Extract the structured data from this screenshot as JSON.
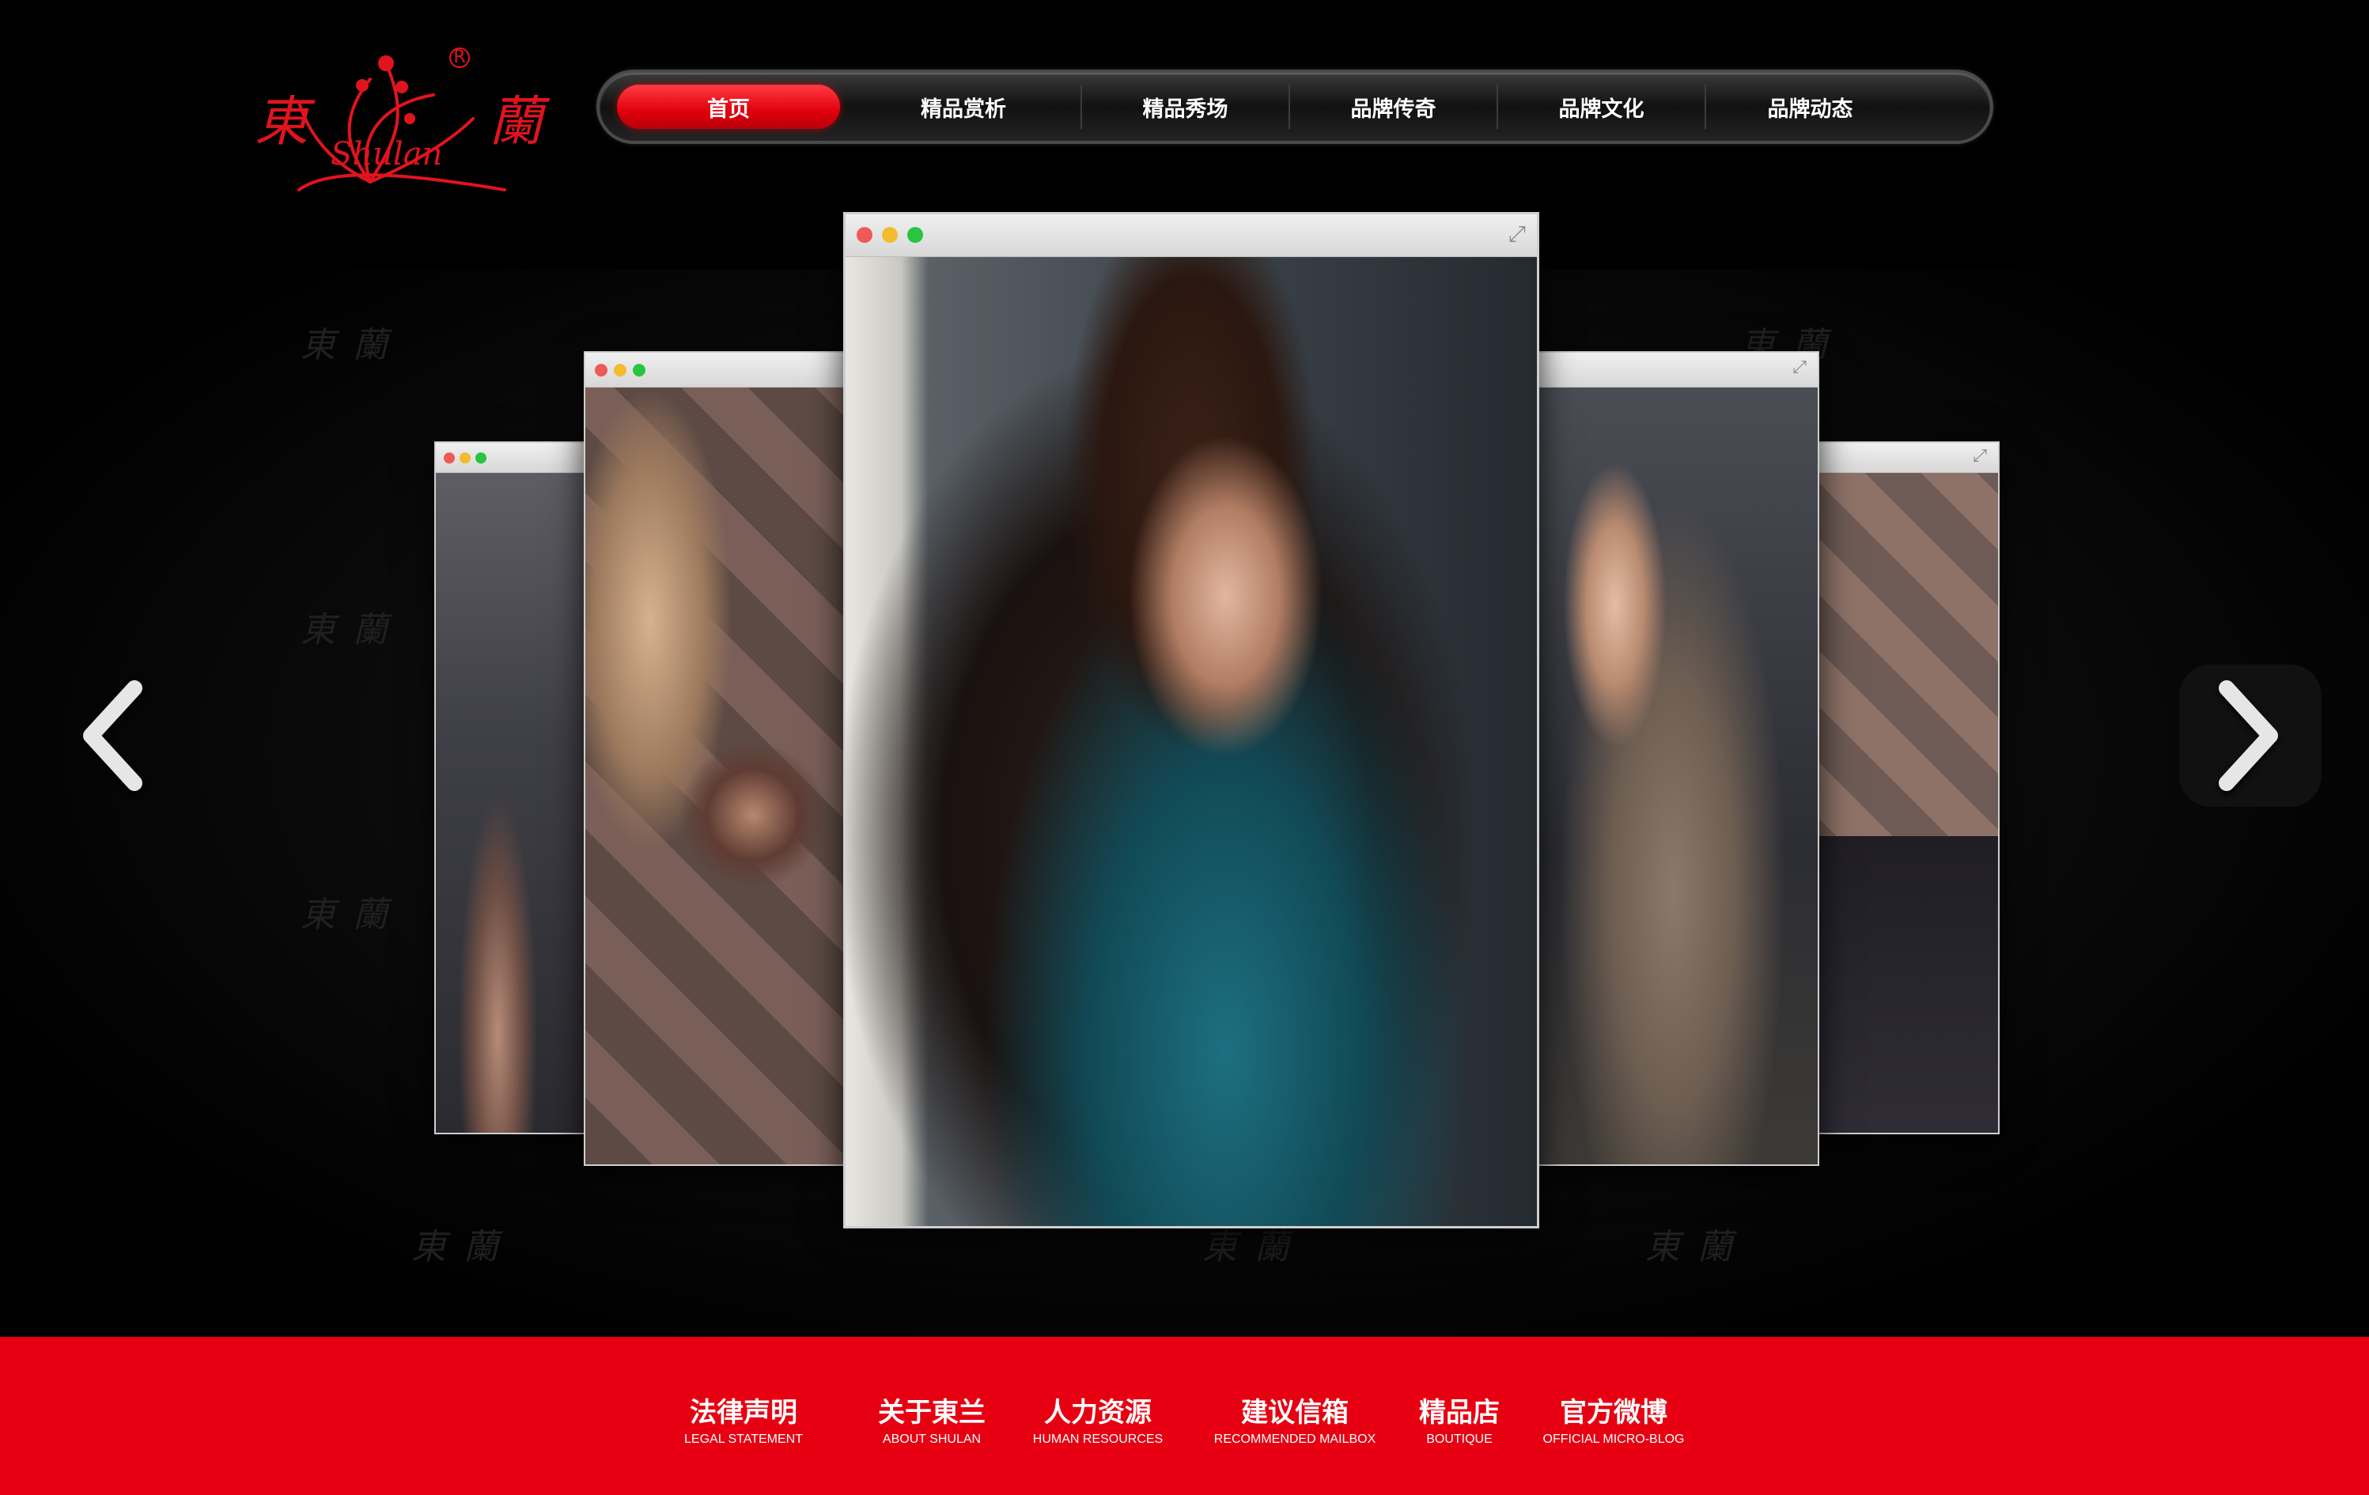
{
  "brand": {
    "logo_cn_left": "東",
    "logo_cn_right": "蘭",
    "logo_script": "Shulan",
    "registered_mark": "R",
    "color": "#e0141e"
  },
  "nav": {
    "items": [
      {
        "label": "首页",
        "active": true
      },
      {
        "label": "精品赏析",
        "active": false
      },
      {
        "label": "精品秀场",
        "active": false
      },
      {
        "label": "品牌传奇",
        "active": false
      },
      {
        "label": "品牌文化",
        "active": false
      },
      {
        "label": "品牌动态",
        "active": false
      }
    ],
    "active_color": "#e1000d"
  },
  "carousel": {
    "prev_icon": "chevron-left-icon",
    "next_icon": "chevron-right-icon",
    "expand_icon": "expand-icon",
    "window_dots": [
      "#ee5a55",
      "#f3bc2e",
      "#27c540"
    ],
    "slides": [
      {
        "name": "slide-far-left"
      },
      {
        "name": "slide-left"
      },
      {
        "name": "slide-center"
      },
      {
        "name": "slide-right"
      },
      {
        "name": "slide-far-right"
      }
    ]
  },
  "footer": {
    "bg_color": "#e60012",
    "links": [
      {
        "cn": "法律声明",
        "en": "LEGAL STATEMENT"
      },
      {
        "cn": "关于東兰",
        "en": "ABOUT SHULAN"
      },
      {
        "cn": "人力资源",
        "en": "HUMAN RESOURCES"
      },
      {
        "cn": "建议信箱",
        "en": "RECOMMENDED MAILBOX"
      },
      {
        "cn": "精品店",
        "en": "BOUTIQUE"
      },
      {
        "cn": "官方微博",
        "en": "OFFICIAL MICRO-BLOG"
      }
    ]
  }
}
